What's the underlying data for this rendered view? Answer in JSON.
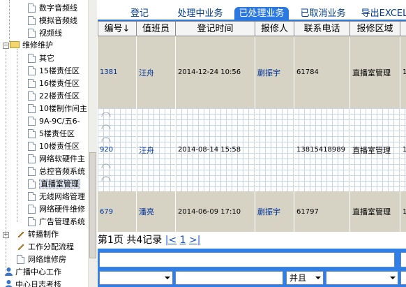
{
  "tree": {
    "items": [
      {
        "label": "数字音频线",
        "indent": 2,
        "kind": "doc"
      },
      {
        "label": "模拟音频线",
        "indent": 2,
        "kind": "doc"
      },
      {
        "label": "视频线",
        "indent": 2,
        "kind": "doc"
      },
      {
        "label": "维修维护",
        "indent": 1,
        "kind": "folder"
      },
      {
        "label": "其它",
        "indent": 2,
        "kind": "doc"
      },
      {
        "label": "15楼责任区",
        "indent": 2,
        "kind": "doc"
      },
      {
        "label": "16楼责任区",
        "indent": 2,
        "kind": "doc"
      },
      {
        "label": "22楼责任区",
        "indent": 2,
        "kind": "doc"
      },
      {
        "label": "10楼制作间主",
        "indent": 2,
        "kind": "doc"
      },
      {
        "label": "9A-9C/五6-",
        "indent": 2,
        "kind": "doc"
      },
      {
        "label": "5楼责任区",
        "indent": 2,
        "kind": "doc"
      },
      {
        "label": "10楼责任区",
        "indent": 2,
        "kind": "doc"
      },
      {
        "label": "网络软硬件主",
        "indent": 2,
        "kind": "doc"
      },
      {
        "label": "总控音频系统",
        "indent": 2,
        "kind": "doc"
      },
      {
        "label": "直播室管理",
        "indent": 2,
        "kind": "doc",
        "selected": true
      },
      {
        "label": "无线网络管理",
        "indent": 2,
        "kind": "doc"
      },
      {
        "label": "网络硬件维修",
        "indent": 2,
        "kind": "doc"
      },
      {
        "label": "广告管理系统",
        "indent": 2,
        "kind": "doc"
      },
      {
        "label": "转播制作",
        "indent": 1,
        "kind": "pen"
      },
      {
        "label": "工作分配流程",
        "indent": 1,
        "kind": "pen"
      },
      {
        "label": "网络维修房",
        "indent": 1,
        "kind": "doc"
      },
      {
        "label": "广播中心工作",
        "indent": 0,
        "kind": "person"
      },
      {
        "label": "中心日志考核",
        "indent": 0,
        "kind": "person"
      }
    ]
  },
  "tabs": [
    {
      "label": "登记",
      "active": false
    },
    {
      "label": "处理中业务",
      "active": false
    },
    {
      "label": "已处理业务",
      "active": true
    },
    {
      "label": "已取消业务",
      "active": false
    },
    {
      "label": "导出EXCEL",
      "active": false
    }
  ],
  "table": {
    "columns": [
      "编号↓",
      "值班员",
      "登记时间",
      "报修人",
      "联系电话",
      "报修区域",
      ""
    ],
    "rows": [
      {
        "id": "1381",
        "staff": "汪舟",
        "time": "2014-12-24 10:56",
        "reporter": "蒯振宇",
        "phone": "61784",
        "area": "直播室管理",
        "extra": "1"
      },
      {
        "id": "920",
        "staff": "汪舟",
        "time": "2014-08-14 15:58",
        "reporter": "",
        "phone": "13815418989",
        "area": "直播室管理",
        "extra": "1"
      },
      {
        "id": "679",
        "staff": "潘亮",
        "time": "2014-06-09 17:10",
        "reporter": "蒯振宇",
        "phone": "61797",
        "area": "直播室管理",
        "extra": "1"
      }
    ]
  },
  "pager": {
    "text": "第1页 共4记录",
    "prev": "|<",
    "page": "1",
    "next": ">|"
  },
  "filter": {
    "logic": "并且"
  }
}
